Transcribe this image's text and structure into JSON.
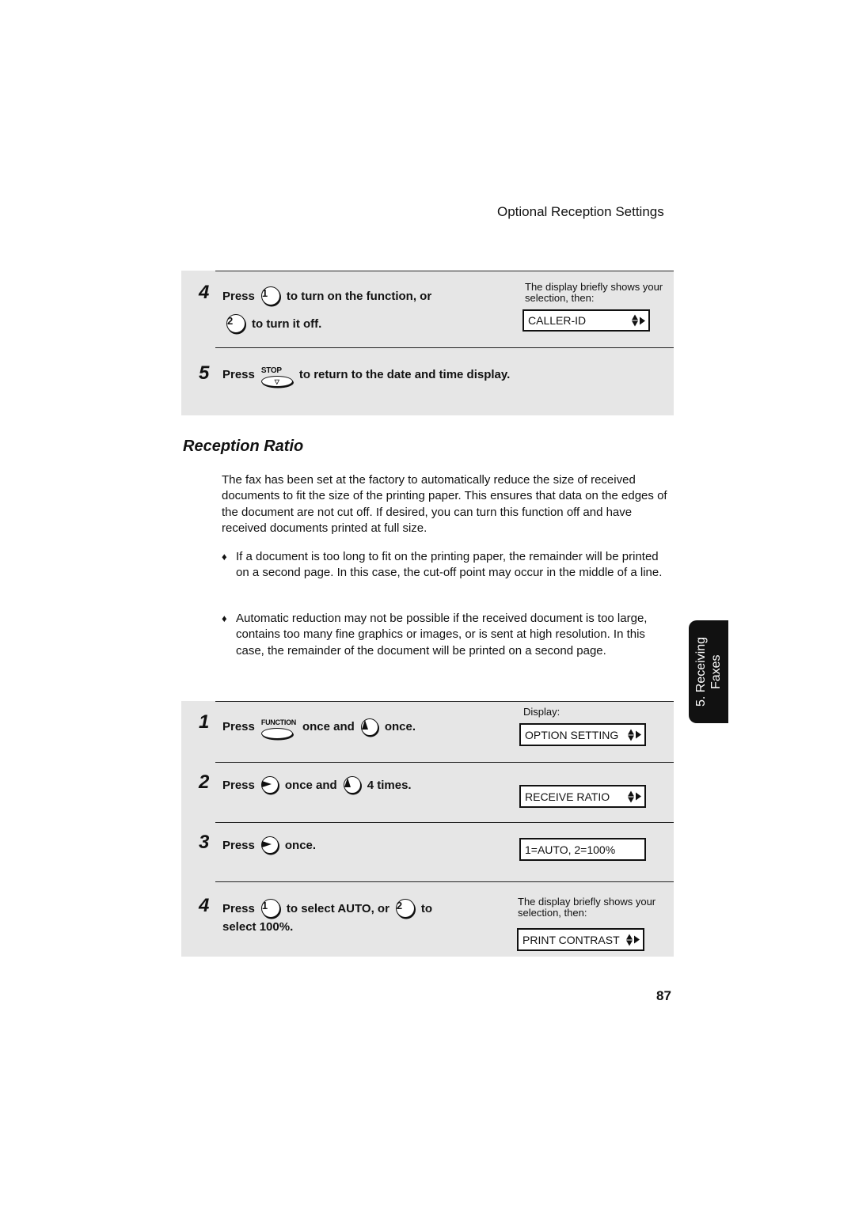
{
  "header": {
    "section_title": "Optional Reception Settings"
  },
  "top_panel": {
    "step4": {
      "number": "4",
      "press": "Press",
      "key1": "1",
      "text1": "to turn on the function, or",
      "key2": "2",
      "text2": "to turn it off.",
      "note": "The display briefly shows your selection, then:",
      "display": "CALLER-ID"
    },
    "step5": {
      "number": "5",
      "press": "Press",
      "key_label": "STOP",
      "text": "to return to the date and time display."
    }
  },
  "section": {
    "title": "Reception Ratio",
    "intro": "The fax has been set at the factory to automatically reduce the size of received documents to fit the size of the printing paper. This ensures that data on the edges of the document are not cut off. If desired, you can turn this function off and have received documents printed at full size.",
    "bullets": [
      "If a document is too long to fit on the printing paper, the remainder will be printed on a second page. In this case, the cut-off point may occur in the middle of a line.",
      "Automatic reduction may not be possible if the received document is too large, contains too many fine graphics or images, or is sent at high resolution. In this case, the remainder of the document will be printed on a second page."
    ],
    "bullet_glyph": "♦"
  },
  "bottom_panel": {
    "display_label": "Display:",
    "step1": {
      "number": "1",
      "press": "Press",
      "key_label": "FUNCTION",
      "mid": "once and",
      "end": "once.",
      "display": "OPTION SETTING"
    },
    "step2": {
      "number": "2",
      "press": "Press",
      "mid": "once and",
      "end": "4 times.",
      "display": "RECEIVE RATIO"
    },
    "step3": {
      "number": "3",
      "press": "Press",
      "end": "once.",
      "display": "1=AUTO, 2=100%"
    },
    "step4": {
      "number": "4",
      "press": "Press",
      "key1": "1",
      "text1": "to select AUTO, or",
      "key2": "2",
      "text2": "to",
      "text3": "select 100%.",
      "note": "The display briefly shows your selection, then:",
      "display": "PRINT CONTRAST"
    }
  },
  "side_tab": {
    "line1": "5. Receiving",
    "line2": "Faxes"
  },
  "page_number": "87"
}
